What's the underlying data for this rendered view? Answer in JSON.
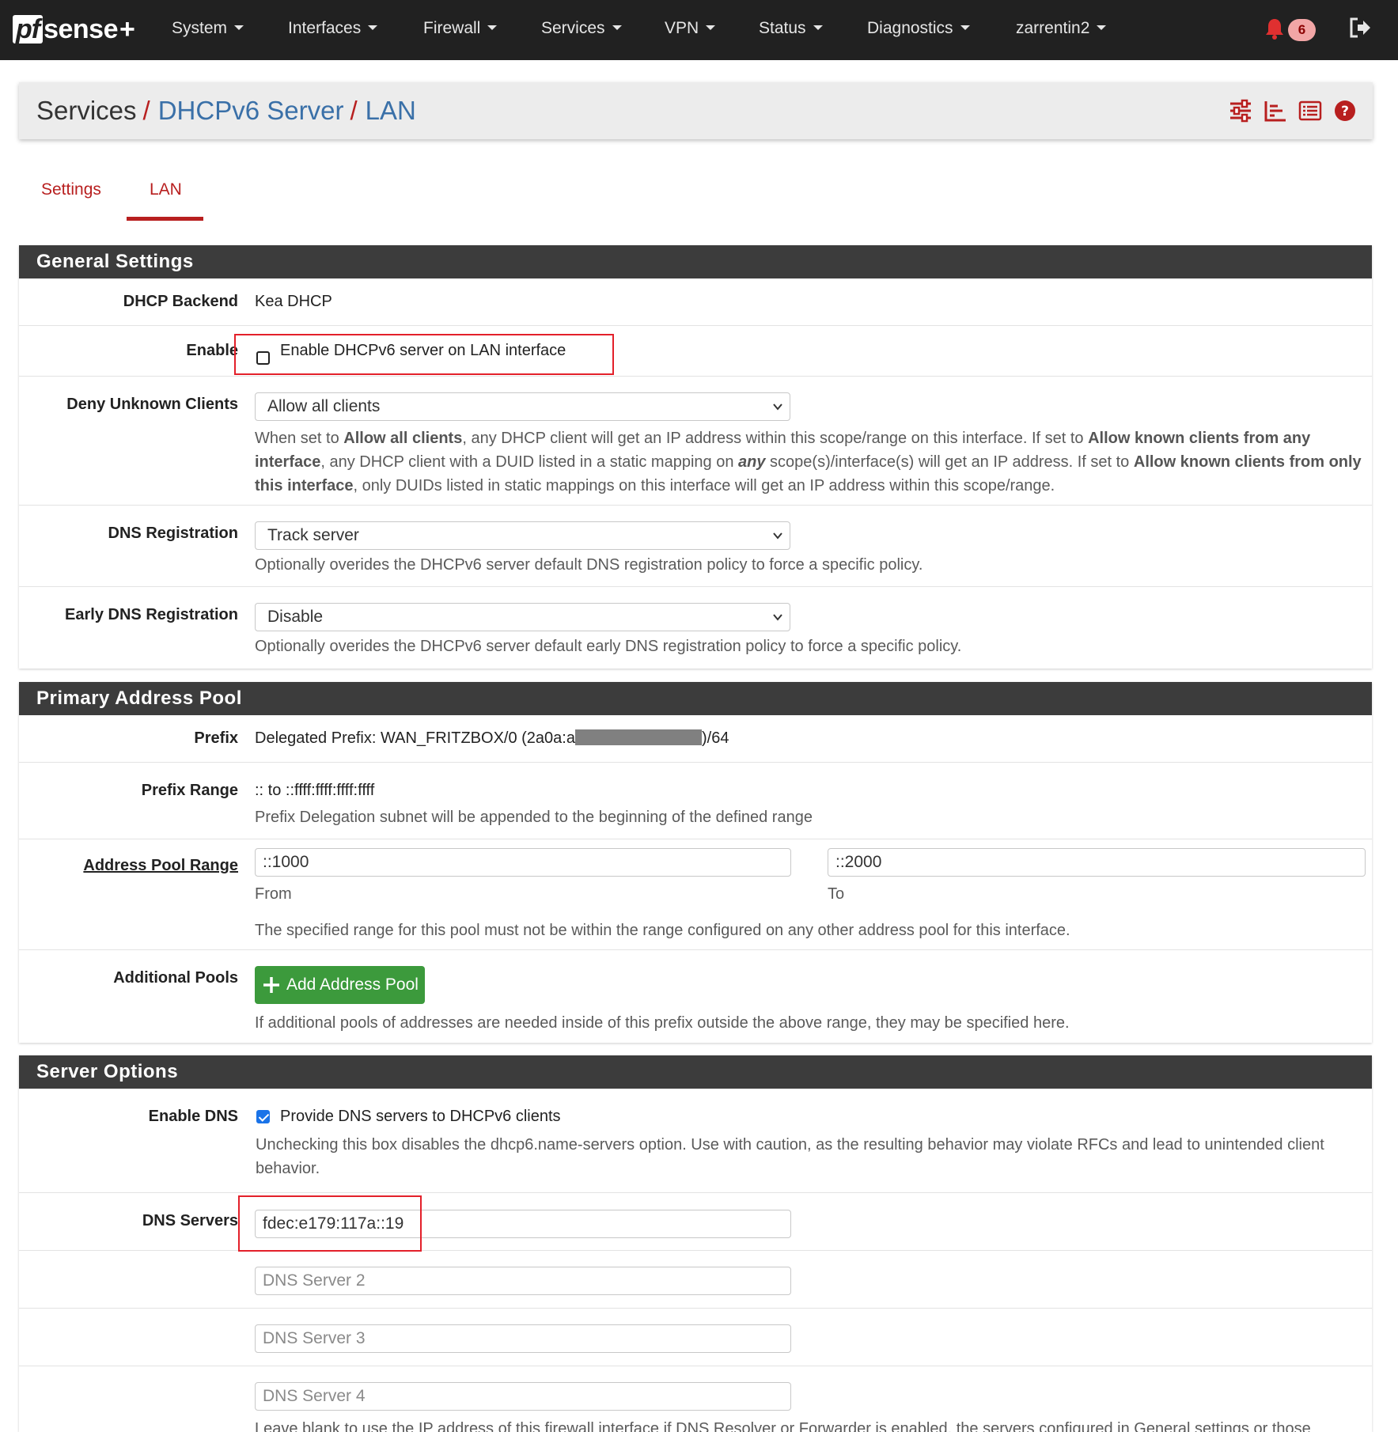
{
  "navbar": {
    "logo_pf": "pf",
    "logo_sense": "sense",
    "logo_plus": "+",
    "items": [
      "System",
      "Interfaces",
      "Firewall",
      "Services",
      "VPN",
      "Status",
      "Diagnostics",
      "zarrentin2"
    ],
    "notification_count": "6",
    "icons": {
      "notifications": "bell-icon",
      "logout": "logout-icon"
    }
  },
  "breadcrumb": {
    "parts": [
      "Services",
      "DHCPv6 Server",
      "LAN"
    ],
    "separator": "/",
    "icons": [
      "sliders-icon",
      "chart-icon",
      "list-icon",
      "help-icon"
    ]
  },
  "tabs": [
    "Settings",
    "LAN"
  ],
  "general": {
    "title": "General Settings",
    "backend_label": "DHCP Backend",
    "backend_value": "Kea DHCP",
    "enable_label": "Enable",
    "enable_text": "Enable DHCPv6 server on LAN interface",
    "enable_checked": false,
    "deny_label": "Deny Unknown Clients",
    "deny_value": "Allow all clients",
    "deny_help": {
      "t1": "When set to ",
      "b1": "Allow all clients",
      "t2": ", any DHCP client will get an IP address within this scope/range on this interface. If set to ",
      "b2": "Allow known clients from any interface",
      "t3": ", any DHCP client with a DUID listed in a static mapping on ",
      "b3": "any",
      "t4": " scope(s)/interface(s) will get an IP address. If set to ",
      "b4": "Allow known clients from only this interface",
      "t5": ", only DUIDs listed in static mappings on this interface will get an IP address within this scope/range."
    },
    "dnsreg_label": "DNS Registration",
    "dnsreg_value": "Track server",
    "dnsreg_help": "Optionally overides the DHCPv6 server default DNS registration policy to force a specific policy.",
    "early_label": "Early DNS Registration",
    "early_value": "Disable",
    "early_help": "Optionally overides the DHCPv6 server default early DNS registration policy to force a specific policy."
  },
  "pool": {
    "title": "Primary Address Pool",
    "prefix_label": "Prefix",
    "prefix_value_start": "Delegated Prefix: WAN_FRITZBOX/0 (2a0a:a",
    "prefix_value_end": ")/64",
    "range_label": "Prefix Range",
    "range_value": ":: to ::ffff:ffff:ffff:ffff",
    "range_help": "Prefix Delegation subnet will be appended to the beginning of the defined range",
    "pool_label": "Address Pool Range",
    "from_value": "::1000",
    "to_value": "::2000",
    "from_label": "From",
    "to_label": "To",
    "pool_help": "The specified range for this pool must not be within the range configured on any other address pool for this interface.",
    "additional_label": "Additional Pools",
    "add_button": "Add Address Pool",
    "additional_help": "If additional pools of addresses are needed inside of this prefix outside the above range, they may be specified here."
  },
  "server": {
    "title": "Server Options",
    "enable_dns_label": "Enable DNS",
    "enable_dns_text": "Provide DNS servers to DHCPv6 clients",
    "enable_dns_checked": true,
    "enable_dns_help": "Unchecking this box disables the dhcp6.name-servers option. Use with caution, as the resulting behavior may violate RFCs and lead to unintended client behavior.",
    "dns_label": "DNS Servers",
    "dns1_value": "fdec:e179:117a::19",
    "dns2_placeholder": "DNS Server 2",
    "dns3_placeholder": "DNS Server 3",
    "dns4_placeholder": "DNS Server 4",
    "dns_help": "Leave blank to use the IP address of this firewall interface if DNS Resolver or Forwarder is enabled, the servers configured in General settings or those"
  },
  "colors": {
    "navbar_bg": "#212121",
    "accent_red": "#b81f1f",
    "link_blue": "#3a70a8",
    "panel_header": "#3c3c3c",
    "button_green": "#3c9a3c",
    "highlight_box": "#e3202a"
  }
}
